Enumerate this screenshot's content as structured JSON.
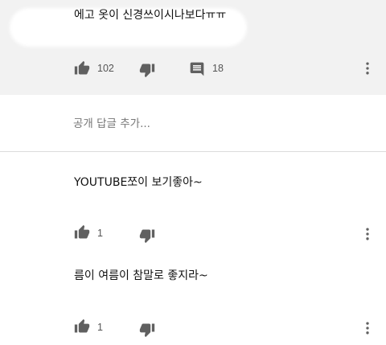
{
  "parent_comment": {
    "text": "에고 옷이 신경쓰이시나보다ㅠㅠ",
    "likes": "102",
    "replies": "18"
  },
  "reply_input": {
    "placeholder": "공개 답글 추가..."
  },
  "replies": [
    {
      "text": "YOUTUBE쪼이 보기좋아~",
      "likes": "1"
    },
    {
      "text": "름이 여름이 참말로 좋지라~",
      "likes": "1"
    }
  ],
  "icons": {
    "like": "thumbs-up-icon",
    "dislike": "thumbs-down-icon",
    "reply": "comment-icon",
    "more": "more-vertical-icon"
  },
  "colors": {
    "background": "#ffffff",
    "highlight_background": "#f2f2f2",
    "icon": "#606060",
    "text": "#111111",
    "muted_text": "#777777"
  }
}
